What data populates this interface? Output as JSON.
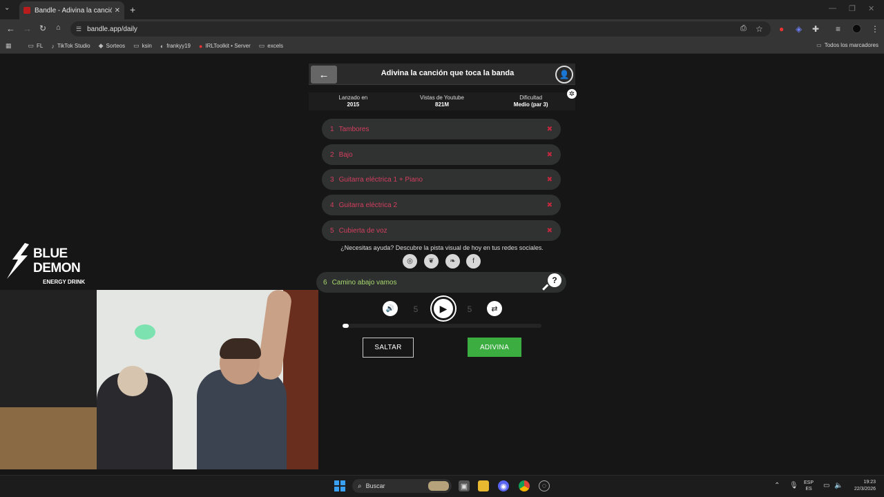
{
  "browser": {
    "tab_title": "Bandle - Adivina la canción, u",
    "new_tab": "+",
    "url": "bandle.app/daily",
    "bookmarks": [
      "FL",
      "TikTok Studio",
      "Sorteos",
      "ksin",
      "frankyy19",
      "IRLToolkit • Server",
      "excels"
    ],
    "all_bookmarks": "Todos los marcadores"
  },
  "game": {
    "title": "Adivina la canción que toca la banda",
    "info": {
      "released_label": "Lanzado en",
      "released_value": "2015",
      "views_label": "Vistas de Youtube",
      "views_value": "821M",
      "difficulty_label": "Dificultad",
      "difficulty_value": "Medio (par 3)"
    },
    "instruments": [
      {
        "num": "1",
        "label": "Tambores",
        "mark": "✖"
      },
      {
        "num": "2",
        "label": "Bajo",
        "mark": "✖"
      },
      {
        "num": "3",
        "label": "Guitarra eléctrica 1 + Piano",
        "mark": "✖"
      },
      {
        "num": "4",
        "label": "Guitarra eléctrica 2",
        "mark": "✖"
      },
      {
        "num": "5",
        "label": "Cubierta de voz",
        "mark": "✖"
      }
    ],
    "help_text": "¿Necesitas ayuda? Descubre la pista visual de hoy en tus redes sociales.",
    "current": {
      "num": "6",
      "label": "Camino abajo vamos"
    },
    "progress_fraction": 0.03,
    "skip_label": "SALTAR",
    "guess_label": "ADIVINA",
    "rewind_seconds": "5",
    "forward_seconds": "5"
  },
  "overlay": {
    "brand_line1": "BLUE",
    "brand_line2": "DEMON",
    "brand_line3": "ENERGY DRINK"
  },
  "taskbar": {
    "search_placeholder": "Buscar",
    "lang_line1": "ESP",
    "lang_line2": "ES",
    "time": "19:23",
    "date": "22/3/2026"
  },
  "colors": {
    "accent_red": "#d33f5e",
    "answer_green": "#a7d96e",
    "guess_button": "#3cad41"
  }
}
